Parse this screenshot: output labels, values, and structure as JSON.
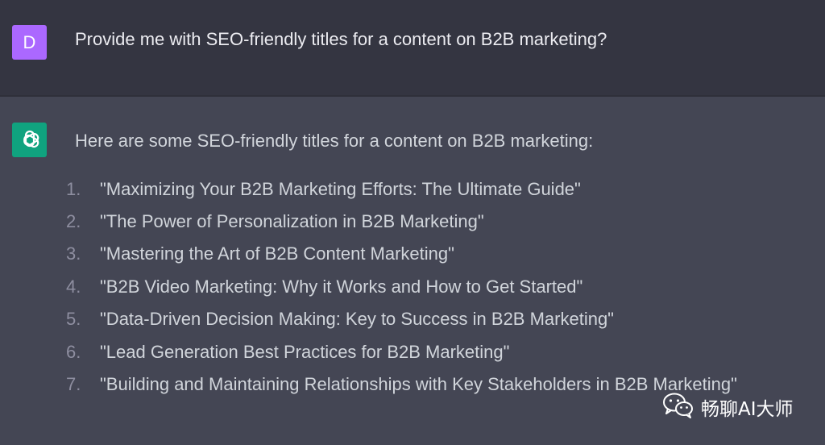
{
  "user_message": {
    "avatar_letter": "D",
    "text": "Provide me with SEO-friendly titles for a content on B2B marketing?"
  },
  "assistant_message": {
    "intro": "Here are some SEO-friendly titles for a content on B2B marketing:",
    "items": [
      {
        "num": "1.",
        "text": "\"Maximizing Your B2B Marketing Efforts: The Ultimate Guide\""
      },
      {
        "num": "2.",
        "text": "\"The Power of Personalization in B2B Marketing\""
      },
      {
        "num": "3.",
        "text": "\"Mastering the Art of B2B Content Marketing\""
      },
      {
        "num": "4.",
        "text": "\"B2B Video Marketing: Why it Works and How to Get Started\""
      },
      {
        "num": "5.",
        "text": "\"Data-Driven Decision Making: Key to Success in B2B Marketing\""
      },
      {
        "num": "6.",
        "text": "\"Lead Generation Best Practices for B2B Marketing\""
      },
      {
        "num": "7.",
        "text": "\"Building and Maintaining Relationships with Key Stakeholders in B2B Marketing\""
      }
    ]
  },
  "watermark": {
    "icon": "wechat-icon",
    "text": "畅聊AI大师"
  },
  "colors": {
    "user_bg": "#343541",
    "assistant_bg": "#444654",
    "user_avatar": "#ab68ff",
    "bot_avatar": "#10a37f"
  }
}
